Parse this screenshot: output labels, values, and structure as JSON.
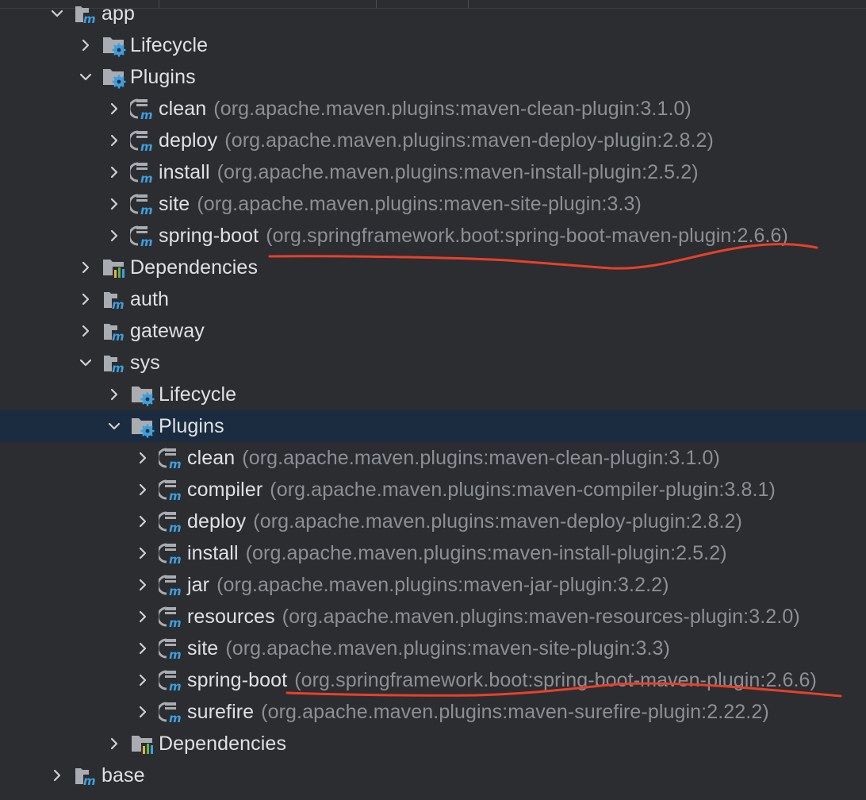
{
  "colors": {
    "background": "#2b2d30",
    "selected_row": "#1b2c40",
    "label_text": "#dfe1e5",
    "coordinate_text": "#8c8f94",
    "annotation_stroke": "#e8402a",
    "maven_m": "#3d9fe0"
  },
  "tree": [
    {
      "level": 1,
      "expanded": true,
      "icon": "maven-module-icon",
      "label": "app"
    },
    {
      "level": 2,
      "expanded": false,
      "icon": "lifecycle-folder-icon",
      "label": "Lifecycle"
    },
    {
      "level": 2,
      "expanded": true,
      "icon": "plugins-folder-icon",
      "label": "Plugins"
    },
    {
      "level": 3,
      "expanded": false,
      "icon": "maven-plugin-icon",
      "label": "clean",
      "coordinates": "(org.apache.maven.plugins:maven-clean-plugin:3.1.0)"
    },
    {
      "level": 3,
      "expanded": false,
      "icon": "maven-plugin-icon",
      "label": "deploy",
      "coordinates": "(org.apache.maven.plugins:maven-deploy-plugin:2.8.2)"
    },
    {
      "level": 3,
      "expanded": false,
      "icon": "maven-plugin-icon",
      "label": "install",
      "coordinates": "(org.apache.maven.plugins:maven-install-plugin:2.5.2)"
    },
    {
      "level": 3,
      "expanded": false,
      "icon": "maven-plugin-icon",
      "label": "site",
      "coordinates": "(org.apache.maven.plugins:maven-site-plugin:3.3)"
    },
    {
      "level": 3,
      "expanded": false,
      "icon": "maven-plugin-icon",
      "label": "spring-boot",
      "coordinates": "(org.springframework.boot:spring-boot-maven-plugin:2.6.6)"
    },
    {
      "level": 2,
      "expanded": false,
      "icon": "dependencies-folder-icon",
      "label": "Dependencies"
    },
    {
      "level": 2,
      "expanded": false,
      "icon": "maven-module-icon",
      "label": "auth"
    },
    {
      "level": 2,
      "expanded": false,
      "icon": "maven-module-icon",
      "label": "gateway"
    },
    {
      "level": 2,
      "expanded": true,
      "icon": "maven-module-icon",
      "label": "sys"
    },
    {
      "level": 3,
      "expanded": false,
      "icon": "lifecycle-folder-icon",
      "label": "Lifecycle"
    },
    {
      "level": 3,
      "expanded": true,
      "icon": "plugins-folder-icon",
      "label": "Plugins",
      "selected": true
    },
    {
      "level": 4,
      "expanded": false,
      "icon": "maven-plugin-icon",
      "label": "clean",
      "coordinates": "(org.apache.maven.plugins:maven-clean-plugin:3.1.0)"
    },
    {
      "level": 4,
      "expanded": false,
      "icon": "maven-plugin-icon",
      "label": "compiler",
      "coordinates": "(org.apache.maven.plugins:maven-compiler-plugin:3.8.1)"
    },
    {
      "level": 4,
      "expanded": false,
      "icon": "maven-plugin-icon",
      "label": "deploy",
      "coordinates": "(org.apache.maven.plugins:maven-deploy-plugin:2.8.2)"
    },
    {
      "level": 4,
      "expanded": false,
      "icon": "maven-plugin-icon",
      "label": "install",
      "coordinates": "(org.apache.maven.plugins:maven-install-plugin:2.5.2)"
    },
    {
      "level": 4,
      "expanded": false,
      "icon": "maven-plugin-icon",
      "label": "jar",
      "coordinates": "(org.apache.maven.plugins:maven-jar-plugin:3.2.2)"
    },
    {
      "level": 4,
      "expanded": false,
      "icon": "maven-plugin-icon",
      "label": "resources",
      "coordinates": "(org.apache.maven.plugins:maven-resources-plugin:3.2.0)"
    },
    {
      "level": 4,
      "expanded": false,
      "icon": "maven-plugin-icon",
      "label": "site",
      "coordinates": "(org.apache.maven.plugins:maven-site-plugin:3.3)"
    },
    {
      "level": 4,
      "expanded": false,
      "icon": "maven-plugin-icon",
      "label": "spring-boot",
      "coordinates": "(org.springframework.boot:spring-boot-maven-plugin:2.6.6)"
    },
    {
      "level": 4,
      "expanded": false,
      "icon": "maven-plugin-icon",
      "label": "surefire",
      "coordinates": "(org.apache.maven.plugins:maven-surefire-plugin:2.22.2)"
    },
    {
      "level": 3,
      "expanded": false,
      "icon": "dependencies-folder-icon",
      "label": "Dependencies"
    },
    {
      "level": 1,
      "expanded": false,
      "icon": "maven-module-icon",
      "label": "base"
    }
  ]
}
